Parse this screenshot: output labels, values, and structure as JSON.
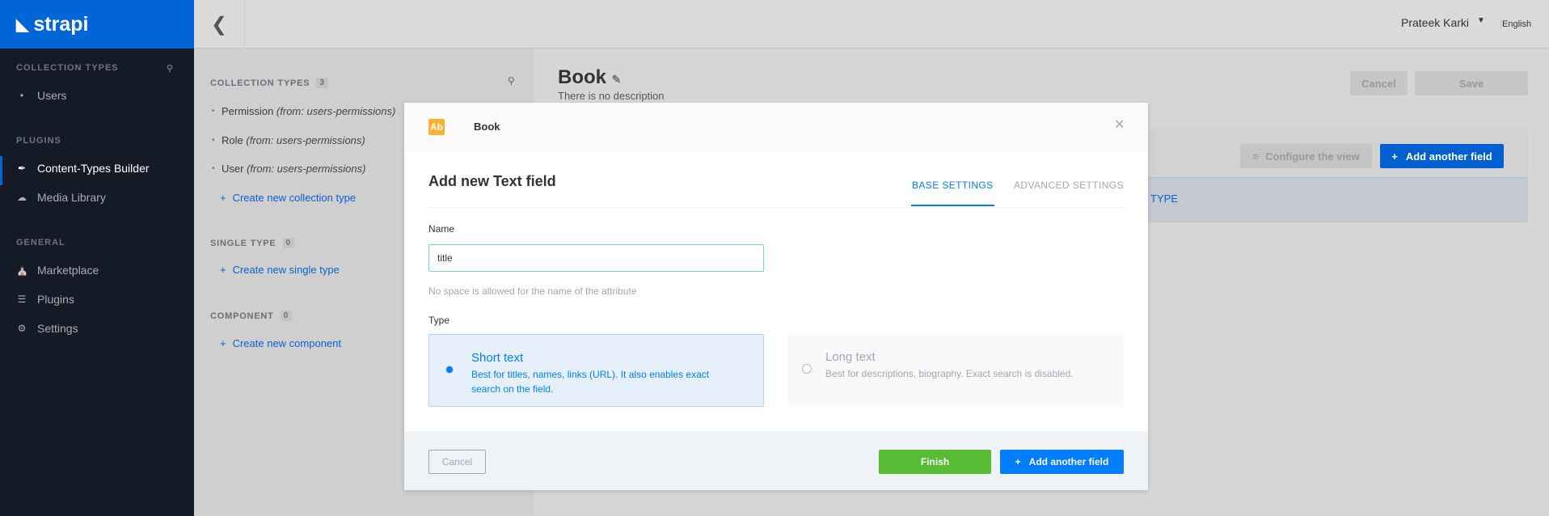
{
  "brand": {
    "name": "strapi"
  },
  "sidebar": {
    "sections": [
      {
        "title": "COLLECTION TYPES",
        "items": [
          {
            "label": "Users",
            "icon": "bullet-icon"
          }
        ]
      },
      {
        "title": "PLUGINS",
        "items": [
          {
            "label": "Content-Types Builder",
            "icon": "brush-icon",
            "active": true
          },
          {
            "label": "Media Library",
            "icon": "cloud-upload-icon"
          }
        ]
      },
      {
        "title": "GENERAL",
        "items": [
          {
            "label": "Marketplace",
            "icon": "basket-icon"
          },
          {
            "label": "Plugins",
            "icon": "list-icon"
          },
          {
            "label": "Settings",
            "icon": "gear-icon"
          }
        ]
      }
    ]
  },
  "header": {
    "user": "Prateek Karki",
    "language": "English"
  },
  "builder": {
    "collection_types": {
      "title": "COLLECTION TYPES",
      "count": "3",
      "items": [
        {
          "name": "Permission",
          "source": "(from: users-permissions)"
        },
        {
          "name": "Role",
          "source": "(from: users-permissions)"
        },
        {
          "name": "User",
          "source": "(from: users-permissions)"
        }
      ],
      "create": "Create new collection type"
    },
    "single_type": {
      "title": "SINGLE TYPE",
      "count": "0",
      "create": "Create new single type"
    },
    "component": {
      "title": "COMPONENT",
      "count": "0",
      "create": "Create new component"
    }
  },
  "page": {
    "title": "Book",
    "description": "There is no description",
    "cancel": "Cancel",
    "save": "Save",
    "configure": "Configure the view",
    "add_field": "Add another field",
    "table_header": "TYPE"
  },
  "modal": {
    "badge": "Ab",
    "entity": "Book",
    "title": "Add new Text field",
    "tabs": [
      "BASE SETTINGS",
      "ADVANCED SETTINGS"
    ],
    "name_label": "Name",
    "name_value": "title",
    "name_help": "No space is allowed for the name of the attribute",
    "type_label": "Type",
    "options": [
      {
        "title": "Short text",
        "desc": "Best for titles, names, links (URL). It also enables exact search on the field.",
        "selected": true
      },
      {
        "title": "Long text",
        "desc": "Best for descriptions, biography. Exact search is disabled.",
        "selected": false
      }
    ],
    "cancel": "Cancel",
    "finish": "Finish",
    "add_another": "Add another field"
  },
  "colors": {
    "brand": "#0065d7",
    "finish": "#58bb34",
    "primary": "#007eff",
    "badge": "#fdb12d"
  }
}
